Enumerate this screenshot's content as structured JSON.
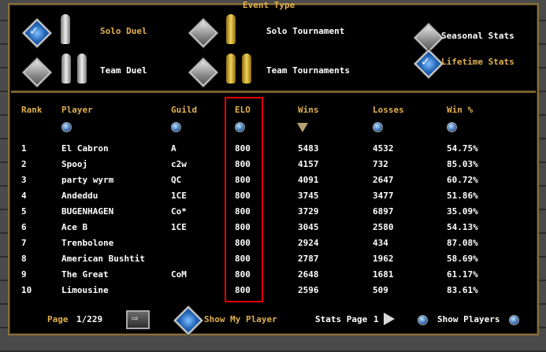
{
  "event_type": {
    "title": "Event Type",
    "options": [
      {
        "label": "Solo Duel",
        "checked": true
      },
      {
        "label": "Solo Tournament",
        "checked": false
      },
      {
        "label": "Team Duel",
        "checked": false
      },
      {
        "label": "Team Tournaments",
        "checked": false
      }
    ],
    "stats": [
      {
        "label": "Seasonal Stats",
        "checked": false
      },
      {
        "label": "Lifetime Stats",
        "checked": true
      }
    ]
  },
  "table": {
    "headers": [
      "Rank",
      "Player",
      "Guild",
      "ELO",
      "Wins",
      "Losses",
      "Win %"
    ],
    "rows": [
      {
        "rank": "1",
        "player": "El Cabron",
        "guild": "A",
        "elo": "800",
        "wins": "5483",
        "losses": "4532",
        "win_pct": "54.75%"
      },
      {
        "rank": "2",
        "player": "Spooj",
        "guild": "c2w",
        "elo": "800",
        "wins": "4157",
        "losses": "732",
        "win_pct": "85.03%"
      },
      {
        "rank": "3",
        "player": "party wyrm",
        "guild": "QC",
        "elo": "800",
        "wins": "4091",
        "losses": "2647",
        "win_pct": "60.72%"
      },
      {
        "rank": "4",
        "player": "Andeddu",
        "guild": "1CE",
        "elo": "800",
        "wins": "3745",
        "losses": "3477",
        "win_pct": "51.86%"
      },
      {
        "rank": "5",
        "player": "BUGENHAGEN",
        "guild": "Co*",
        "elo": "800",
        "wins": "3729",
        "losses": "6897",
        "win_pct": "35.09%"
      },
      {
        "rank": "6",
        "player": "Ace B",
        "guild": "1CE",
        "elo": "800",
        "wins": "3045",
        "losses": "2580",
        "win_pct": "54.13%"
      },
      {
        "rank": "7",
        "player": "Trenbolone",
        "guild": "",
        "elo": "800",
        "wins": "2924",
        "losses": "434",
        "win_pct": "87.08%"
      },
      {
        "rank": "8",
        "player": "American Bushtit",
        "guild": "",
        "elo": "800",
        "wins": "2787",
        "losses": "1962",
        "win_pct": "58.69%"
      },
      {
        "rank": "9",
        "player": "The Great",
        "guild": "CoM",
        "elo": "800",
        "wins": "2648",
        "losses": "1681",
        "win_pct": "61.17%"
      },
      {
        "rank": "10",
        "player": "Limousine",
        "guild": "",
        "elo": "800",
        "wins": "2596",
        "losses": "509",
        "win_pct": "83.61%"
      }
    ]
  },
  "footer": {
    "page_label": "Page",
    "page_value": "1/229",
    "show_my_player": "Show My Player",
    "stats_page_label": "Stats Page",
    "stats_page_value": "1",
    "show_players": "Show Players"
  },
  "colors": {
    "gold_text": "#e0b050",
    "highlight_box": "#e00000"
  }
}
